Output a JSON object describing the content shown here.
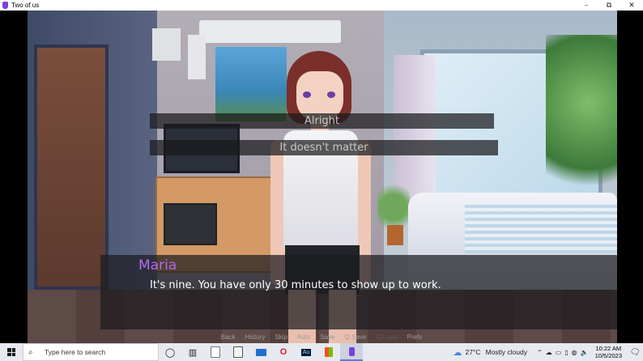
{
  "window": {
    "title": "Two of us",
    "controls": {
      "minimize": "–",
      "maximize": "⧉",
      "close": "✕"
    }
  },
  "choices": [
    {
      "label": "Alright"
    },
    {
      "label": "It doesn't matter"
    }
  ],
  "dialogue": {
    "speaker": "Maria",
    "speaker_color": "#b36af2",
    "text": "It's nine. You have only 30 minutes to show up to work."
  },
  "quick_menu": [
    {
      "label": "Back",
      "enabled": true
    },
    {
      "label": "History",
      "enabled": true
    },
    {
      "label": "Skip",
      "enabled": true
    },
    {
      "label": "Auto",
      "enabled": true
    },
    {
      "label": "Save",
      "enabled": true
    },
    {
      "label": "Q.Save",
      "enabled": true
    },
    {
      "label": "Q.Load",
      "enabled": false
    },
    {
      "label": "Prefs",
      "enabled": true
    }
  ],
  "taskbar": {
    "search_placeholder": "Type here to search",
    "weather": {
      "temp": "27°C",
      "condition": "Mostly cloudy",
      "icon": "partly-cloudy-icon"
    },
    "clock": {
      "time": "10:22 AM",
      "date": "10/5/2023"
    },
    "pinned_icons": [
      "cortana-icon",
      "task-view-icon",
      "file-icon",
      "document-icon",
      "mail-icon",
      "opera-icon",
      "audition-icon",
      "store-icon",
      "game-app-icon"
    ]
  }
}
